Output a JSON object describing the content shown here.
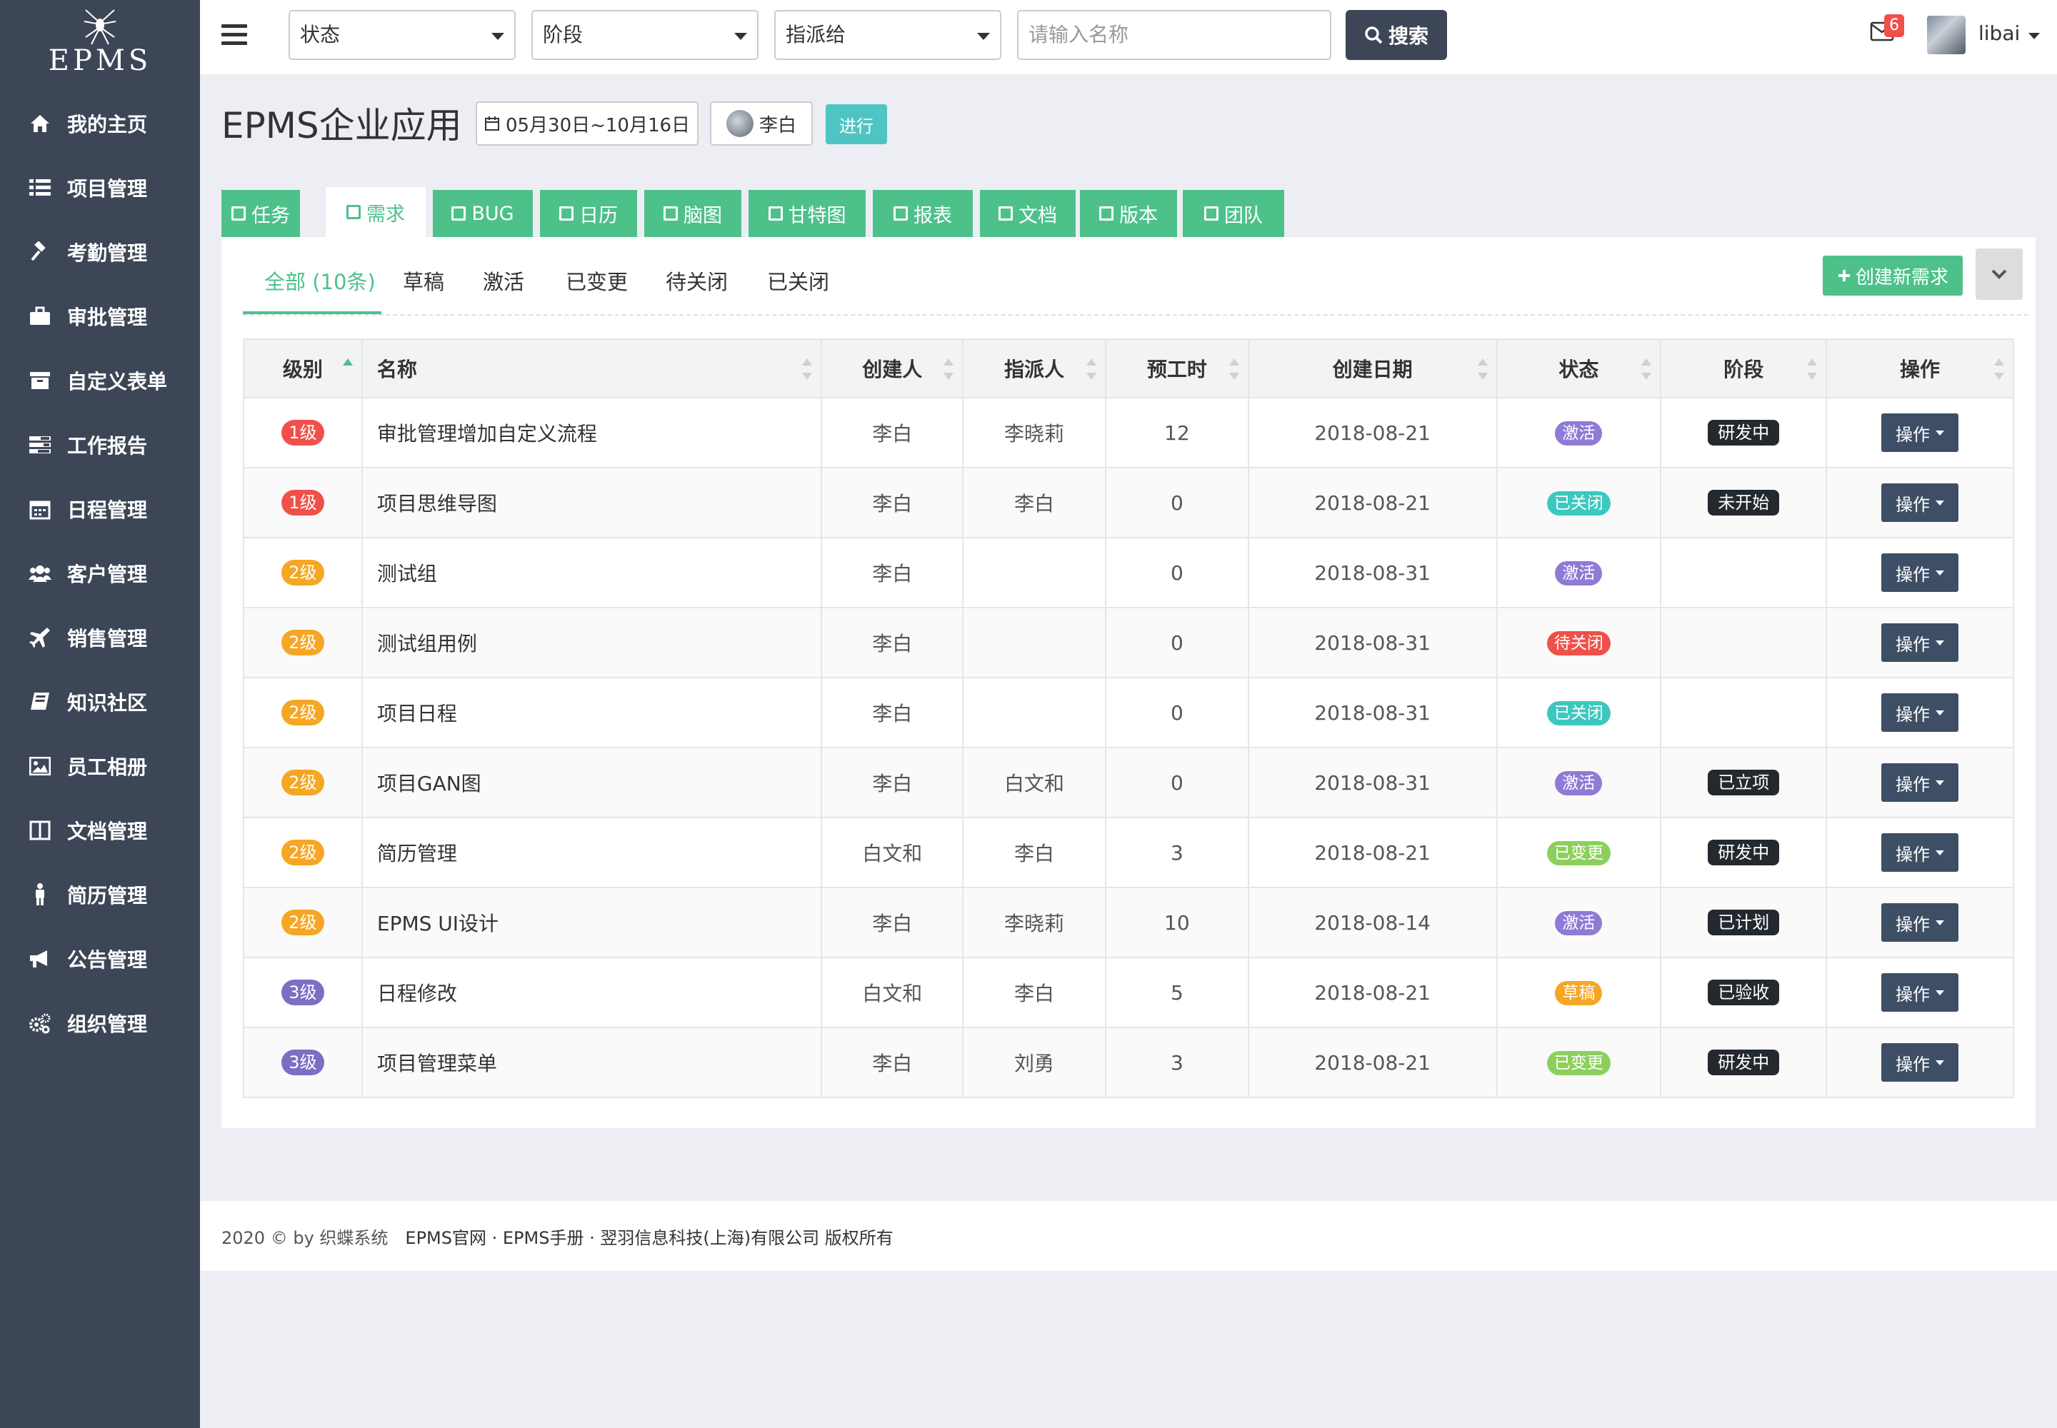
{
  "brand": {
    "name": "EPMS"
  },
  "sidebar": {
    "items": [
      {
        "label": "我的主页",
        "icon": "home-icon"
      },
      {
        "label": "项目管理",
        "icon": "list-icon"
      },
      {
        "label": "考勤管理",
        "icon": "gavel-icon"
      },
      {
        "label": "审批管理",
        "icon": "briefcase-icon"
      },
      {
        "label": "自定义表单",
        "icon": "archive-icon"
      },
      {
        "label": "工作报告",
        "icon": "tasks-icon"
      },
      {
        "label": "日程管理",
        "icon": "calendar-icon"
      },
      {
        "label": "客户管理",
        "icon": "users-icon"
      },
      {
        "label": "销售管理",
        "icon": "plane-icon"
      },
      {
        "label": "知识社区",
        "icon": "book-icon"
      },
      {
        "label": "员工相册",
        "icon": "image-icon"
      },
      {
        "label": "文档管理",
        "icon": "columns-icon"
      },
      {
        "label": "简历管理",
        "icon": "male-icon"
      },
      {
        "label": "公告管理",
        "icon": "bullhorn-icon"
      },
      {
        "label": "组织管理",
        "icon": "cogs-icon"
      }
    ]
  },
  "topbar": {
    "filters": [
      {
        "value": "状态"
      },
      {
        "value": "阶段"
      },
      {
        "value": "指派给"
      }
    ],
    "search_placeholder": "请输入名称",
    "search_label": "搜索",
    "mail_count": "6",
    "username": "libai"
  },
  "header": {
    "title": "EPMS企业应用",
    "date_range": "05月30日~10月16日",
    "owner": "李白",
    "status": "进行"
  },
  "module_tabs": [
    {
      "label": "任务",
      "active": false
    },
    {
      "label": "需求",
      "active": true
    },
    {
      "label": "BUG",
      "active": false
    },
    {
      "label": "日历",
      "active": false
    },
    {
      "label": "脑图",
      "active": false
    },
    {
      "label": "甘特图",
      "active": false
    },
    {
      "label": "报表",
      "active": false
    },
    {
      "label": "文档",
      "active": false
    },
    {
      "label": "版本",
      "active": false
    },
    {
      "label": "团队",
      "active": false
    }
  ],
  "sub_tabs": [
    {
      "label": "全部 (10条)",
      "active": true
    },
    {
      "label": "草稿",
      "active": false
    },
    {
      "label": "激活",
      "active": false
    },
    {
      "label": "已变更",
      "active": false
    },
    {
      "label": "待关闭",
      "active": false
    },
    {
      "label": "已关闭",
      "active": false
    }
  ],
  "create_label": "创建新需求",
  "table": {
    "headers": [
      "级别",
      "名称",
      "创建人",
      "指派人",
      "预工时",
      "创建日期",
      "状态",
      "阶段",
      "操作"
    ],
    "rows": [
      {
        "level": "1级",
        "name": "审批管理增加自定义流程",
        "creator": "李白",
        "assignee": "李晓莉",
        "hours": "12",
        "date": "2018-08-21",
        "status": "激活",
        "stage": "研发中",
        "action": "操作"
      },
      {
        "level": "1级",
        "name": "项目思维导图",
        "creator": "李白",
        "assignee": "李白",
        "hours": "0",
        "date": "2018-08-21",
        "status": "已关闭",
        "stage": "未开始",
        "action": "操作"
      },
      {
        "level": "2级",
        "name": "测试组",
        "creator": "李白",
        "assignee": "",
        "hours": "0",
        "date": "2018-08-31",
        "status": "激活",
        "stage": "",
        "action": "操作"
      },
      {
        "level": "2级",
        "name": "测试组用例",
        "creator": "李白",
        "assignee": "",
        "hours": "0",
        "date": "2018-08-31",
        "status": "待关闭",
        "stage": "",
        "action": "操作"
      },
      {
        "level": "2级",
        "name": "项目日程",
        "creator": "李白",
        "assignee": "",
        "hours": "0",
        "date": "2018-08-31",
        "status": "已关闭",
        "stage": "",
        "action": "操作"
      },
      {
        "level": "2级",
        "name": "项目GAN图",
        "creator": "李白",
        "assignee": "白文和",
        "hours": "0",
        "date": "2018-08-31",
        "status": "激活",
        "stage": "已立项",
        "action": "操作"
      },
      {
        "level": "2级",
        "name": "简历管理",
        "creator": "白文和",
        "assignee": "李白",
        "hours": "3",
        "date": "2018-08-21",
        "status": "已变更",
        "stage": "研发中",
        "action": "操作"
      },
      {
        "level": "2级",
        "name": "EPMS UI设计",
        "creator": "李白",
        "assignee": "李晓莉",
        "hours": "10",
        "date": "2018-08-14",
        "status": "激活",
        "stage": "已计划",
        "action": "操作"
      },
      {
        "level": "3级",
        "name": "日程修改",
        "creator": "白文和",
        "assignee": "李白",
        "hours": "5",
        "date": "2018-08-21",
        "status": "草稿",
        "stage": "已验收",
        "action": "操作"
      },
      {
        "level": "3级",
        "name": "项目管理菜单",
        "creator": "李白",
        "assignee": "刘勇",
        "hours": "3",
        "date": "2018-08-21",
        "status": "已变更",
        "stage": "研发中",
        "action": "操作"
      }
    ]
  },
  "colors": {
    "accent": "#4ec18b",
    "sidebar": "#3c4656",
    "level_1": "#f0504a",
    "level_2": "#f5a623",
    "level_3": "#7b6fc4",
    "status_active": "#8f7ad6",
    "status_closed": "#3cc8c0",
    "status_pending": "#f0504a",
    "status_changed": "#8bd05c",
    "status_draft": "#f5a623"
  },
  "footer": {
    "copyright": "2020 © by 织蝶系统",
    "link1": "EPMS官网",
    "link2": "EPMS手册",
    "company": "翌羽信息科技(上海)有限公司 版权所有"
  }
}
